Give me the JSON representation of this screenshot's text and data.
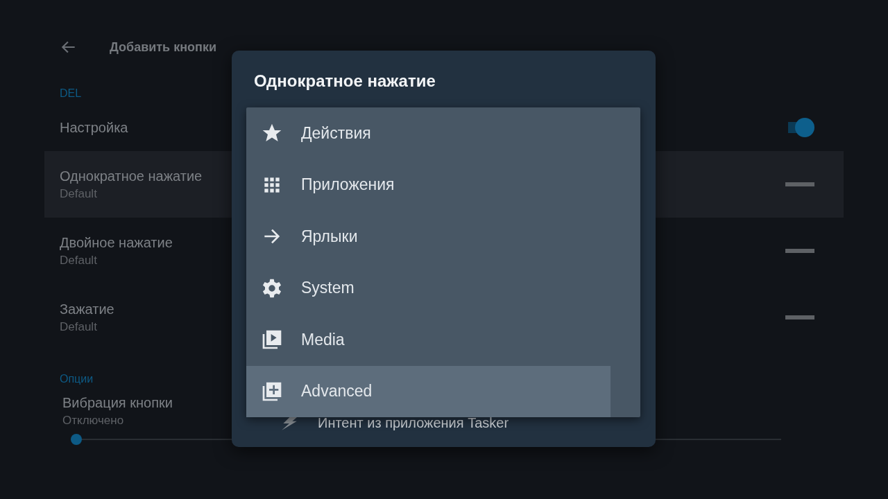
{
  "header": {
    "title": "Добавить кнопки"
  },
  "sections": [
    {
      "label": "DEL",
      "rows": [
        {
          "kind": "toggle",
          "title": "Настройка",
          "on": true,
          "selected": false
        },
        {
          "kind": "dash",
          "title": "Однократное нажатие",
          "subtitle": "Default",
          "selected": true
        },
        {
          "kind": "dash",
          "title": "Двойное нажатие",
          "subtitle": "Default",
          "selected": false
        },
        {
          "kind": "dash",
          "title": "Зажатие",
          "subtitle": "Default",
          "selected": false
        }
      ]
    },
    {
      "label": "Опции",
      "rows": [
        {
          "kind": "slider",
          "title": "Вибрация кнопки",
          "subtitle": "Отключено",
          "level": 0,
          "selected": false
        }
      ]
    }
  ],
  "dialog": {
    "title": "Однократное нажатие",
    "list_item": "Интент из приложения Tasker",
    "menu": [
      {
        "kind": "star",
        "label": "Действия",
        "selected": false
      },
      {
        "kind": "grid",
        "label": "Приложения",
        "selected": false
      },
      {
        "kind": "arrow",
        "label": "Ярлыки",
        "selected": false
      },
      {
        "kind": "gear",
        "label": "System",
        "selected": false
      },
      {
        "kind": "media",
        "label": "Media",
        "selected": false
      },
      {
        "kind": "add",
        "label": "Advanced",
        "selected": true
      }
    ]
  }
}
